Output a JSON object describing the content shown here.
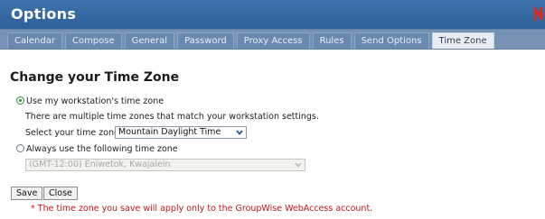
{
  "window": {
    "title": "Options"
  },
  "tabs": [
    {
      "label": "Calendar",
      "active": false
    },
    {
      "label": "Compose",
      "active": false
    },
    {
      "label": "General",
      "active": false
    },
    {
      "label": "Password",
      "active": false
    },
    {
      "label": "Proxy Access",
      "active": false
    },
    {
      "label": "Rules",
      "active": false
    },
    {
      "label": "Send Options",
      "active": false
    },
    {
      "label": "Time Zone",
      "active": true
    }
  ],
  "main": {
    "heading": "Change your Time Zone",
    "option_workstation": {
      "label": "Use my workstation's time zone",
      "selected": true
    },
    "multiple_tz_text": "There are multiple time zones that match your workstation settings.",
    "select_tz_label": "Select your time zone:",
    "select_tz_value": "Mountain Daylight Time",
    "option_always": {
      "label": "Always use the following time zone",
      "selected": false
    },
    "always_tz_value": "(GMT-12:00) Eniwetok, Kwajalein",
    "save_label": "Save",
    "close_label": "Close",
    "note": "* The time zone you save will apply only to the GroupWise WebAccess account."
  },
  "colors": {
    "titlebar": "#3a6ba5",
    "tabbar": "#7693b5",
    "radio_accent": "#2d8b2d",
    "note_text": "#c0161a",
    "corner_mark": "#e0271b"
  },
  "icons": {
    "corner_mark": "red-corner-mark-icon",
    "dropdown_arrow": "chevron-down-icon"
  }
}
